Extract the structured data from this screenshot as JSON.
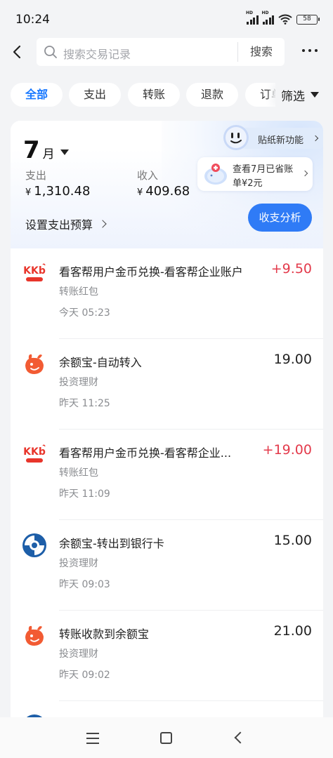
{
  "status_bar": {
    "time": "10:24",
    "battery": "58",
    "signal_badge": "HD"
  },
  "header": {
    "search_placeholder": "搜索交易记录",
    "search_button": "搜索"
  },
  "tabs": [
    {
      "label": "全部",
      "active": true
    },
    {
      "label": "支出",
      "active": false
    },
    {
      "label": "转账",
      "active": false
    },
    {
      "label": "退款",
      "active": false
    },
    {
      "label": "订单",
      "active": false
    }
  ],
  "filter_label": "筛选",
  "summary": {
    "month": "7",
    "month_unit": "月",
    "expense_label": "支出",
    "expense_value": "1,310.48",
    "income_label": "收入",
    "income_value": "409.68",
    "currency": "¥",
    "budget_link": "设置支出预算",
    "analysis_button": "收支分析",
    "sticker_tip": "贴纸新功能",
    "save_tip_line1": "查看7月已省账",
    "save_tip_line2": "单¥2元"
  },
  "transactions": [
    {
      "icon": "kkb-logo-icon",
      "title": "看客帮用户金币兑换-看客帮企业账户",
      "amount": "+9.50",
      "positive": true,
      "category": "转账红包",
      "time": "今天 05:23"
    },
    {
      "icon": "yuebao-icon",
      "title": "余额宝-自动转入",
      "amount": "19.00",
      "positive": false,
      "category": "投资理财",
      "time": "昨天 11:25"
    },
    {
      "icon": "kkb-logo-icon",
      "title": "看客帮用户金币兑换-看客帮企业...",
      "amount": "+19.00",
      "positive": true,
      "category": "转账红包",
      "time": "昨天 11:09"
    },
    {
      "icon": "ccb-bank-icon",
      "title": "余额宝-转出到银行卡",
      "amount": "15.00",
      "positive": false,
      "category": "投资理财",
      "time": "昨天 09:03"
    },
    {
      "icon": "yuebao-icon",
      "title": "转账收款到余额宝",
      "amount": "21.00",
      "positive": false,
      "category": "投资理财",
      "time": "昨天 09:02"
    }
  ],
  "colors": {
    "accent": "#1677ff",
    "button": "#2f7bf6",
    "positive_amount": "#e33a4b",
    "background": "#f3f4f6"
  }
}
